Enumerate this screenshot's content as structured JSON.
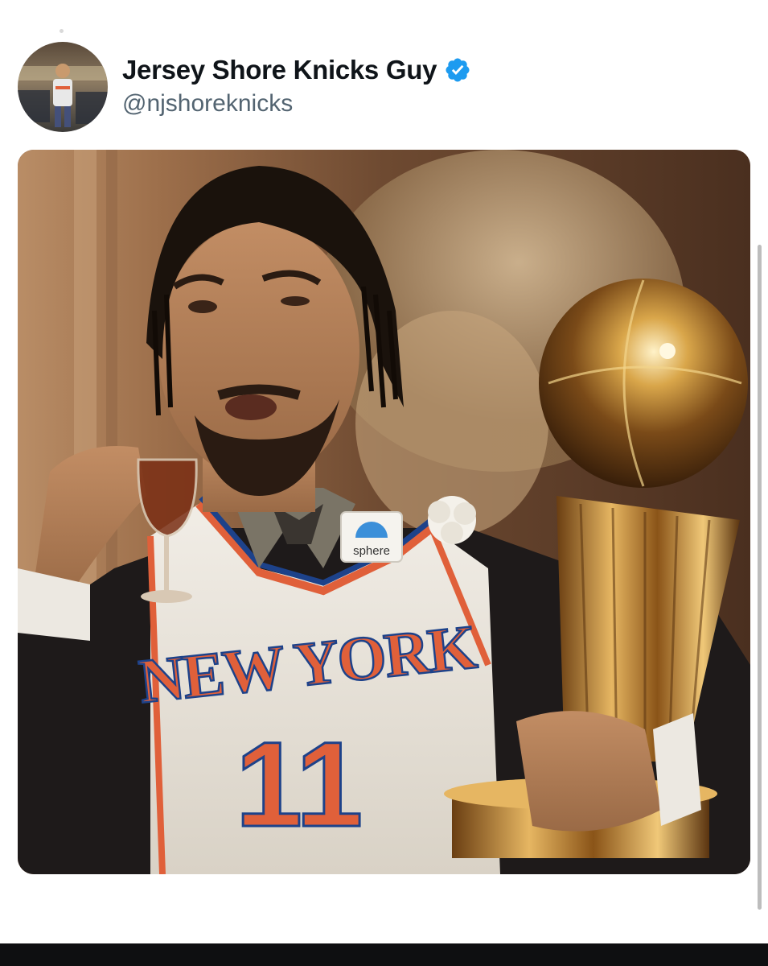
{
  "post": {
    "display_name": "Jersey Shore Knicks Guy",
    "handle": "@njshoreknicks",
    "verified": true,
    "verified_icon": "verified-badge-icon",
    "accent_color": "#1d9bf0"
  },
  "media": {
    "jersey_wordmark": "NEW YORK",
    "jersey_number": "11",
    "patch_text": "sphere",
    "jersey_accent": "#e0603a",
    "jersey_trim": "#1d428a"
  }
}
